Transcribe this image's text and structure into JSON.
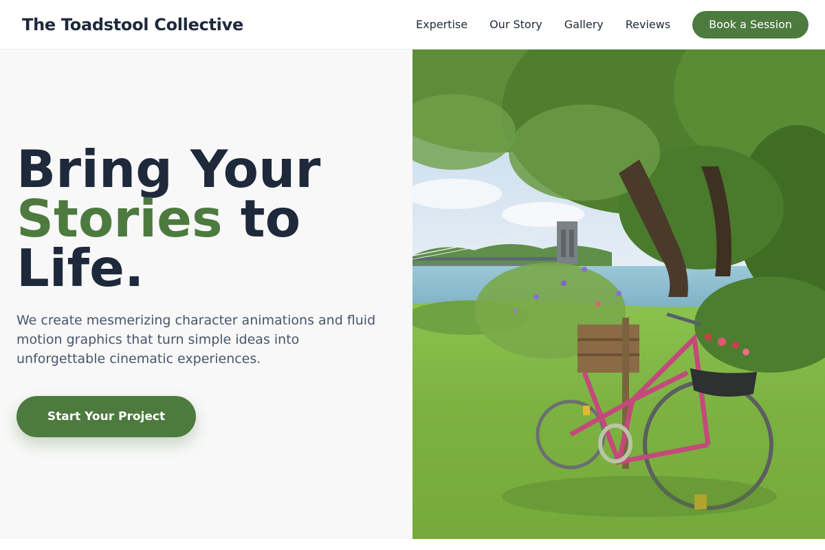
{
  "header": {
    "brand": "The Toadstool Collective",
    "nav": [
      "Expertise",
      "Our Story",
      "Gallery",
      "Reviews"
    ],
    "cta": "Book a Session"
  },
  "hero": {
    "headline_part1": "Bring Your",
    "headline_accent": "Stories",
    "headline_part2": "to",
    "headline_part3": "Life.",
    "subtext": "We create mesmerizing character animations and fluid motion graphics that turn simple ideas into unforgettable cinematic experiences.",
    "cta": "Start Your Project",
    "image_subject": "pink bicycle with flower baskets under a tree by a river with a suspension bridge"
  },
  "colors": {
    "accent": "#4d7a3e",
    "heading": "#1e293b",
    "body_text": "#475569",
    "hero_background": "#f8f8f8"
  }
}
